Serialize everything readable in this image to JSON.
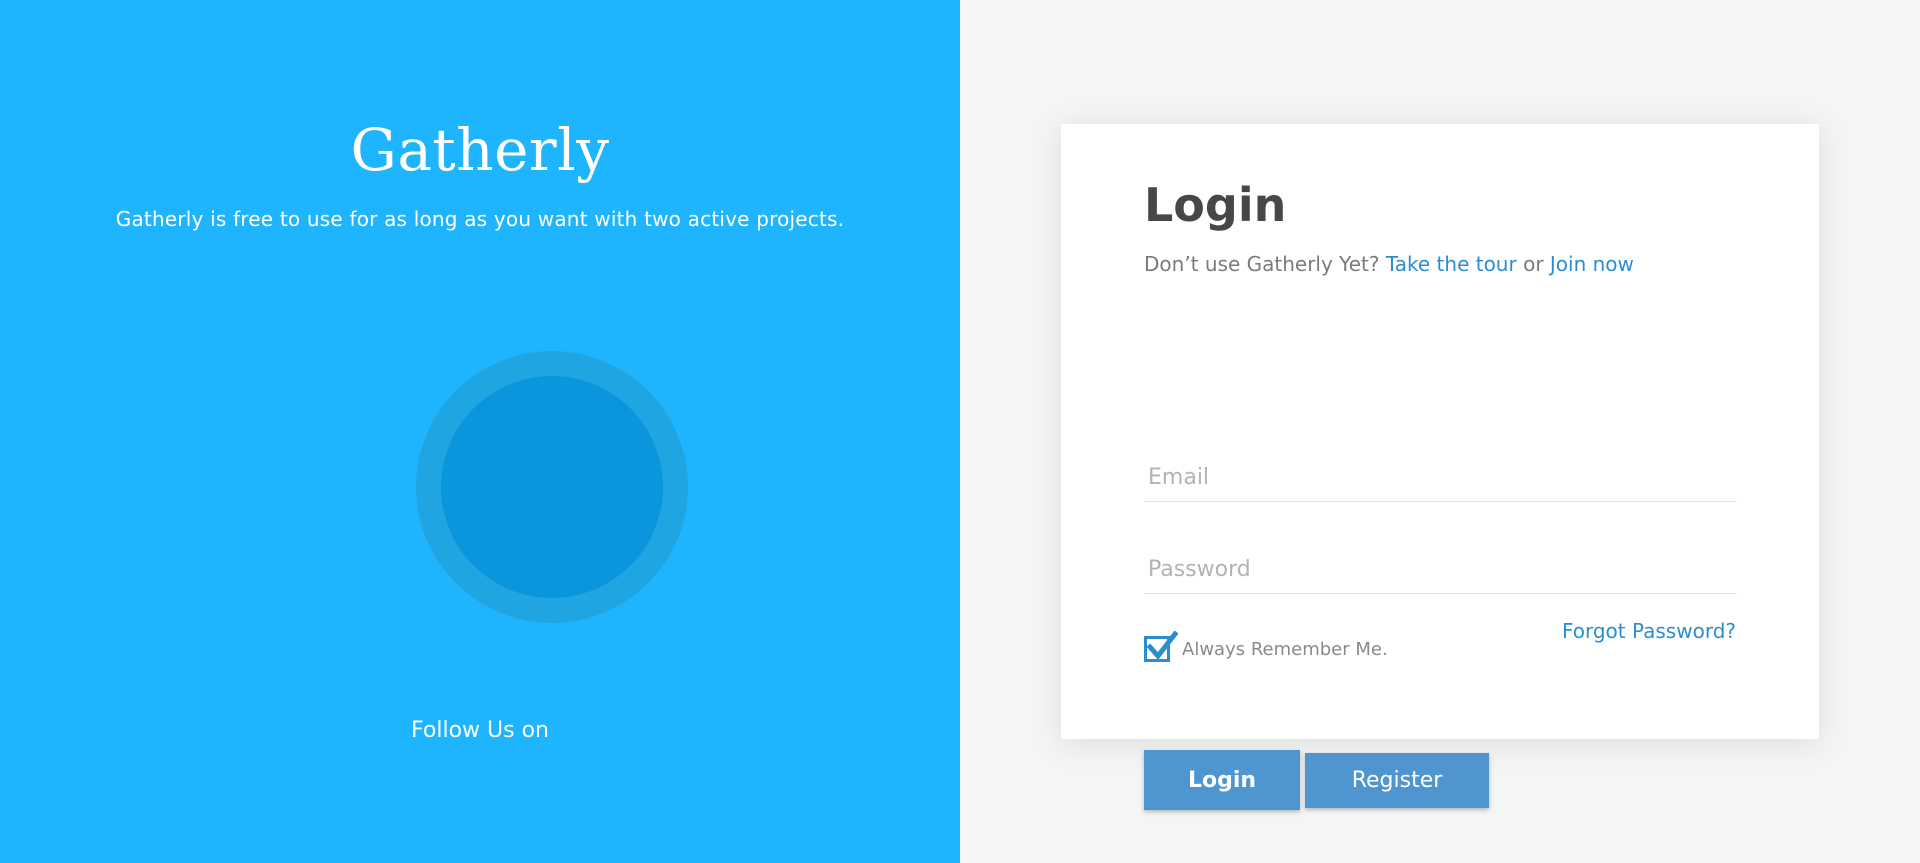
{
  "brand": {
    "name": "Gatherly",
    "tagline": "Gatherly is free to use for as long as you want with two active projects.",
    "follow_text": "Follow Us on"
  },
  "login": {
    "heading": "Login",
    "tagline_prefix": "Don’t use Gatherly Yet?",
    "tour_link": "Take the tour",
    "or_text": "or",
    "join_link": "Join now",
    "email_placeholder": "Email",
    "password_placeholder": "Password",
    "remember_label": "Always Remember Me.",
    "remember_checked": true,
    "forgot_link": "Forgot Password?",
    "login_button": "Login",
    "register_button": "Register"
  },
  "colors": {
    "left_panel_bg": "#1fb5fe",
    "right_panel_bg": "#f4f5f5",
    "accent": "#2a8fce",
    "button_bg": "#4f95d0",
    "heading_text": "#474747"
  },
  "icons": {
    "avatar": "avatar-placeholder-icon",
    "checkbox": "checkmark-icon"
  }
}
